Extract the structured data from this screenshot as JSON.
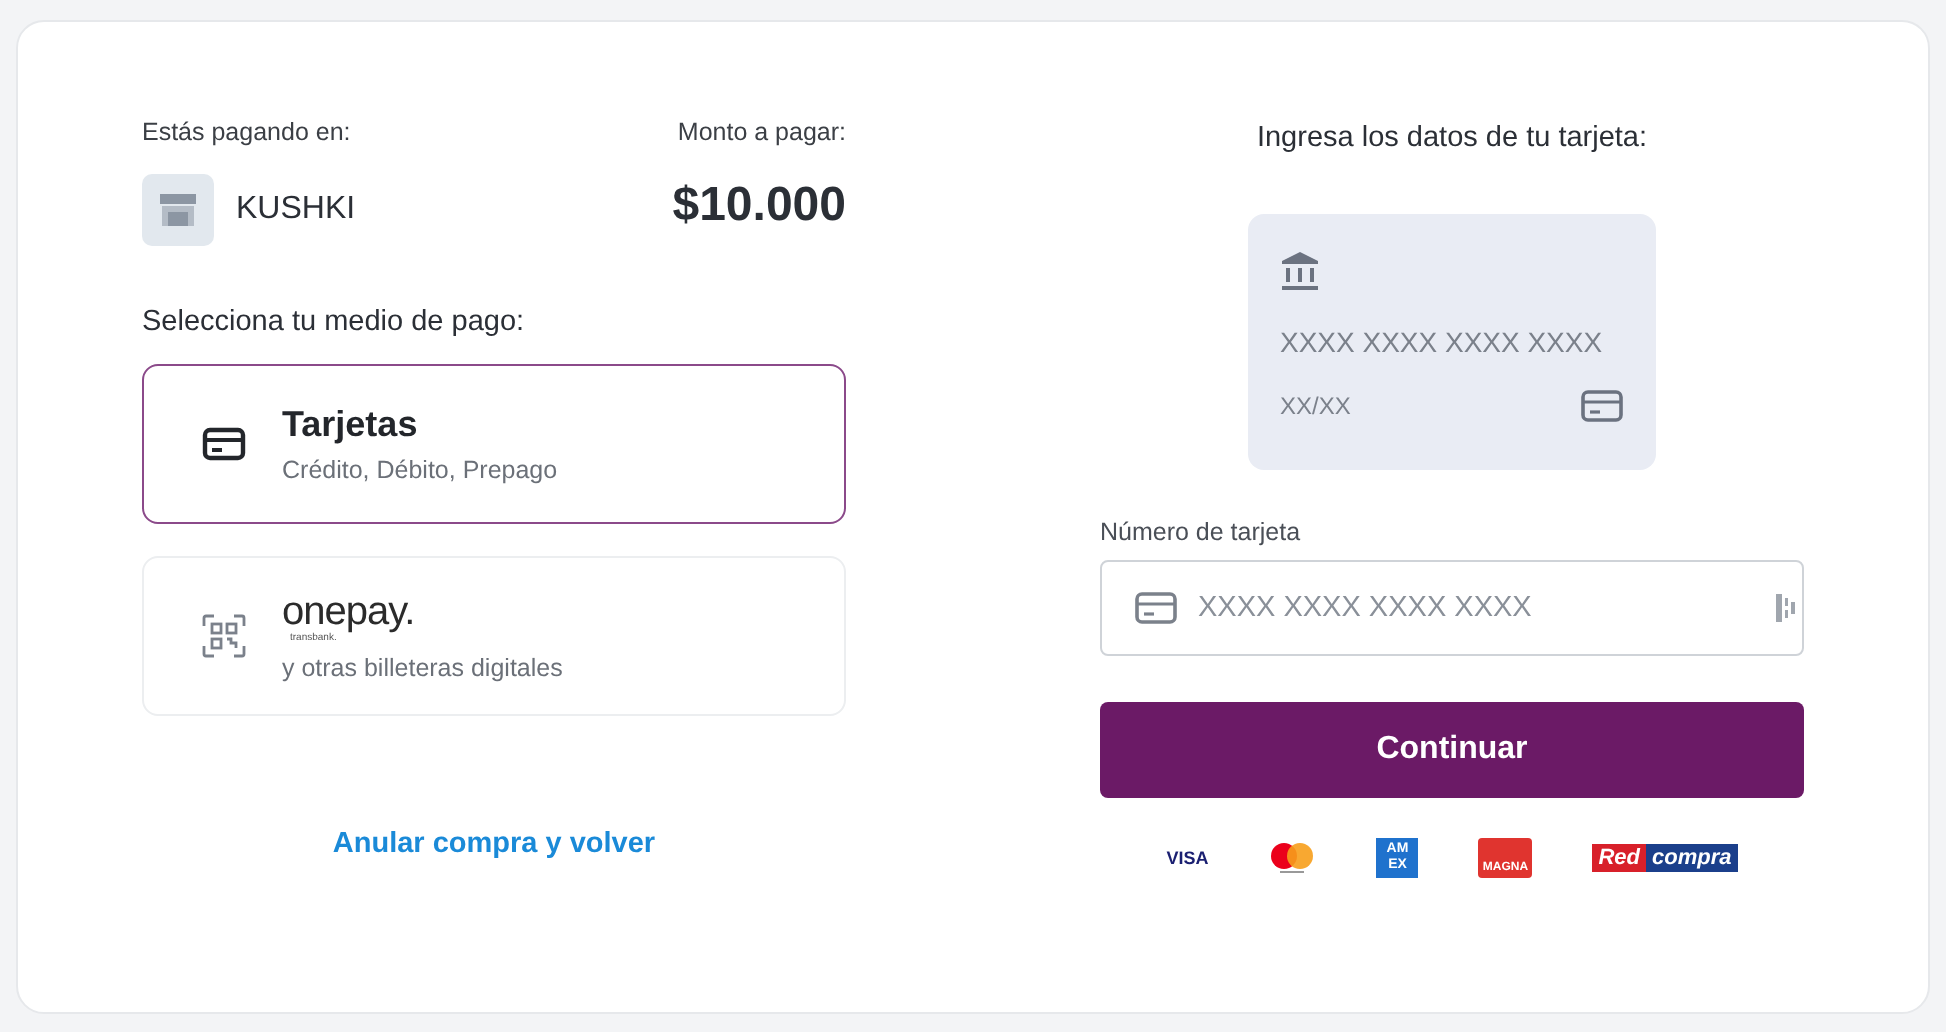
{
  "merchant": {
    "label": "Estás pagando en:",
    "name": "KUSHKI"
  },
  "amount": {
    "label": "Monto a pagar:",
    "value": "$10.000"
  },
  "methods_title": "Selecciona tu medio de pago:",
  "methods": [
    {
      "kind": "card",
      "selected": true,
      "title": "Tarjetas",
      "subtitle": "Crédito, Débito, Prepago"
    },
    {
      "kind": "wallet",
      "selected": false,
      "title": "onepay.",
      "brand_sub": "transbank.",
      "subtitle": "y otras billeteras digitales"
    }
  ],
  "cancel_link": "Anular compra y volver",
  "card_title": "Ingresa los datos de tu tarjeta:",
  "card_preview": {
    "number": "XXXX XXXX XXXX XXXX",
    "expiry": "XX/XX"
  },
  "card_number": {
    "label": "Número de tarjeta",
    "placeholder": "XXXX XXXX XXXX XXXX"
  },
  "submit": "Continuar",
  "brands": [
    {
      "kind": "visa",
      "label": "VISA"
    },
    {
      "kind": "mastercard"
    },
    {
      "kind": "amex",
      "label": "AM EX"
    },
    {
      "kind": "magna",
      "label": "MAGNA"
    },
    {
      "kind": "redcompra",
      "label": "Red",
      "label2": "compra"
    }
  ]
}
